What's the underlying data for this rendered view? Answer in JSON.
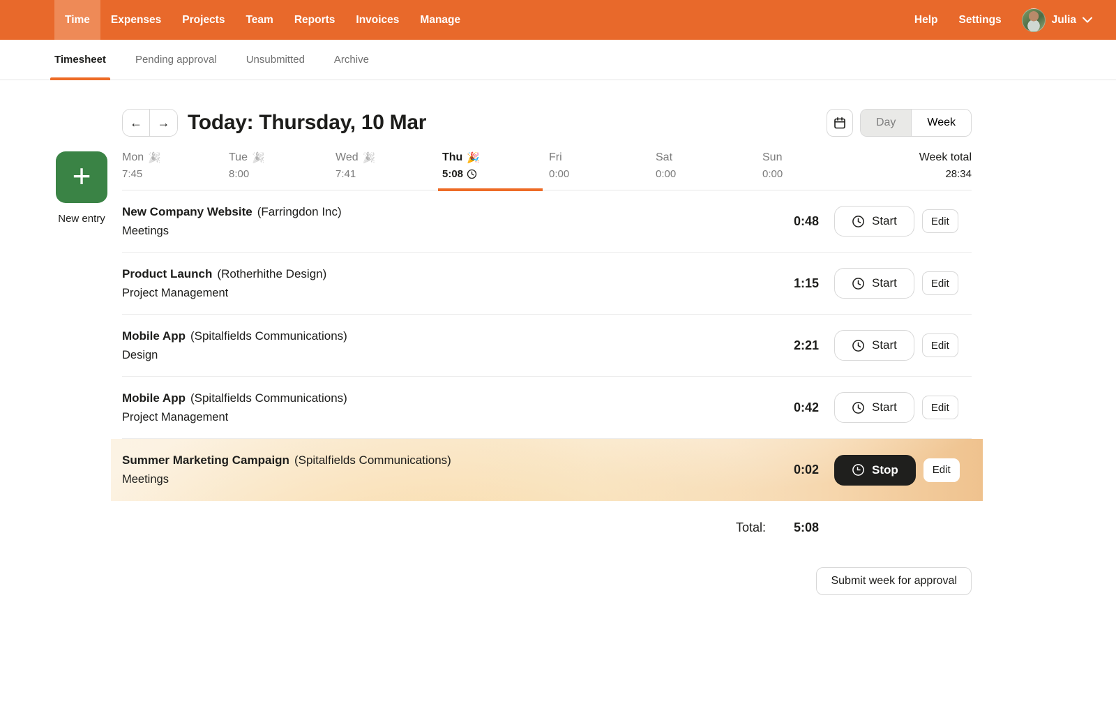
{
  "nav": {
    "items": [
      {
        "label": "Time"
      },
      {
        "label": "Expenses"
      },
      {
        "label": "Projects"
      },
      {
        "label": "Team"
      },
      {
        "label": "Reports"
      },
      {
        "label": "Invoices"
      },
      {
        "label": "Manage"
      }
    ],
    "help": "Help",
    "settings": "Settings",
    "user": "Julia"
  },
  "tabs": [
    {
      "label": "Timesheet"
    },
    {
      "label": "Pending approval"
    },
    {
      "label": "Unsubmitted"
    },
    {
      "label": "Archive"
    }
  ],
  "header": {
    "prev_icon": "←",
    "next_icon": "→",
    "today_label": "Today:",
    "date": " Thursday, 10 Mar",
    "day_toggle": "Day",
    "week_toggle": "Week"
  },
  "new_entry": {
    "plus": "+",
    "label": "New entry"
  },
  "week": {
    "days": [
      {
        "name": "Mon",
        "emoji": "🎉",
        "time": "7:45"
      },
      {
        "name": "Tue",
        "emoji": "🎉",
        "time": "8:00"
      },
      {
        "name": "Wed",
        "emoji": "🎉",
        "time": "7:41"
      },
      {
        "name": "Thu",
        "emoji": "🎉",
        "time": "5:08"
      },
      {
        "name": "Fri",
        "emoji": "",
        "time": "0:00"
      },
      {
        "name": "Sat",
        "emoji": "",
        "time": "0:00"
      },
      {
        "name": "Sun",
        "emoji": "",
        "time": "0:00"
      }
    ],
    "total_label": "Week total",
    "total": "28:34"
  },
  "entries": [
    {
      "project": "New Company Website",
      "client": "(Farringdon Inc)",
      "task": "Meetings",
      "time": "0:48",
      "action": "Start",
      "edit": "Edit"
    },
    {
      "project": "Product Launch",
      "client": "(Rotherhithe Design)",
      "task": "Project Management",
      "time": "1:15",
      "action": "Start",
      "edit": "Edit"
    },
    {
      "project": "Mobile App",
      "client": "(Spitalfields Communications)",
      "task": "Design",
      "time": "2:21",
      "action": "Start",
      "edit": "Edit"
    },
    {
      "project": "Mobile App",
      "client": "(Spitalfields Communications)",
      "task": "Project Management",
      "time": "0:42",
      "action": "Start",
      "edit": "Edit"
    },
    {
      "project": "Summer Marketing Campaign",
      "client": "(Spitalfields Communications)",
      "task": "Meetings",
      "time": "0:02",
      "action": "Stop",
      "edit": "Edit"
    }
  ],
  "summary": {
    "label": "Total:",
    "value": "5:08"
  },
  "submit_label": "Submit week for approval",
  "colors": {
    "nav_orange": "#e8692b",
    "nav_active_bg": "#ee8a57",
    "accent_orange": "#ed6b26",
    "new_entry_green": "#3a8345",
    "stop_button": "#1f1f1d",
    "running_row_start": "#fcf3e4",
    "running_row_end": "#efc28e"
  }
}
